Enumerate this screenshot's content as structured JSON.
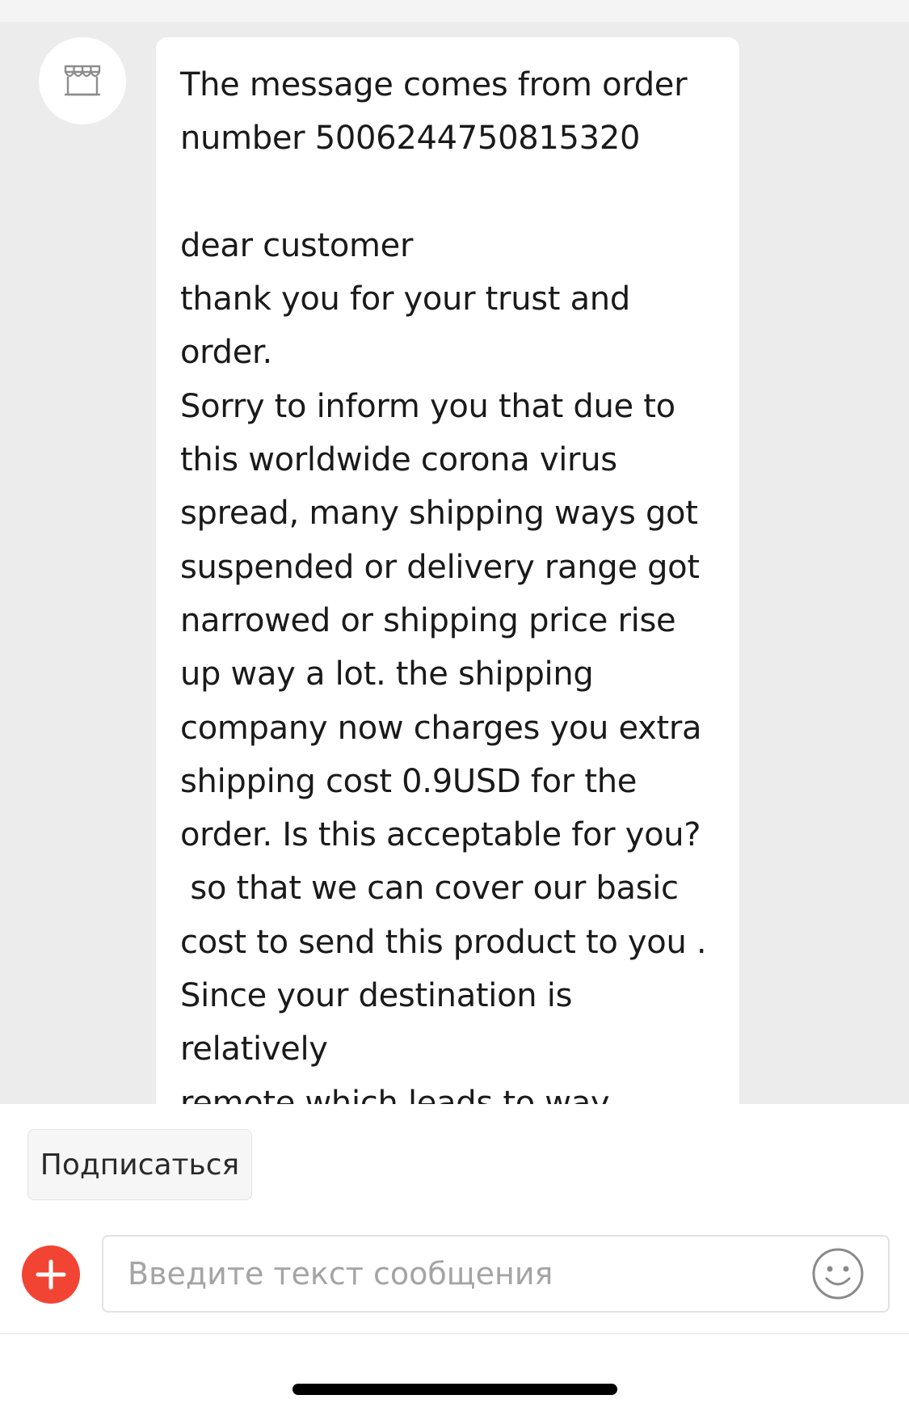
{
  "chat": {
    "sender_icon": "store-icon",
    "message_text": "The message comes from order\nnumber 5006244750815320\n\ndear customer\nthank you for your trust and\norder.\nSorry to inform you that due to\nthis worldwide corona virus\nspread, many shipping ways got\nsuspended or delivery range got\nnarrowed or shipping price rise\nup way a lot. the shipping\ncompany now charges you extra\nshipping cost 0.9USD for the\norder. Is this acceptable for you?\n so that we can cover our basic\ncost to send this product to you .\nSince your destination is relatively\nremote which leads to way higher\nshipping fee than we expected"
  },
  "actions": {
    "subscribe_label": "Подписаться"
  },
  "composer": {
    "add_icon": "plus-icon",
    "placeholder": "Введите текст сообщения",
    "value": "",
    "emoji_icon": "smiley-icon"
  },
  "colors": {
    "chat_background": "#ececec",
    "bubble_background": "#ffffff",
    "accent_red": "#f24433"
  }
}
